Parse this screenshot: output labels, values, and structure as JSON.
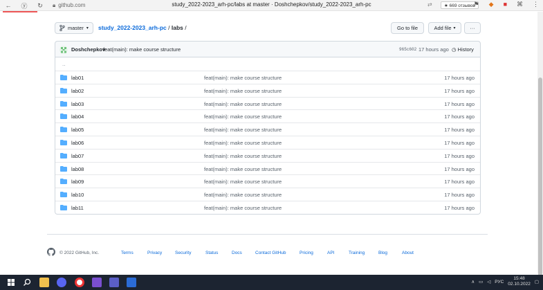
{
  "browser": {
    "url": "github.com",
    "title": "study_2022-2023_arh-pc/labs at master · Doshchepkov/study_2022-2023_arh-pc",
    "reviews_badge": "★ 669 отзывов"
  },
  "toolbar": {
    "branch": "master",
    "repo_name": "study_2022-2023_arh-pc",
    "path_separator": "/",
    "folder": "labs",
    "trailing": "/",
    "go_to_file": "Go to file",
    "add_file": "Add file",
    "more": "···"
  },
  "commit": {
    "author": "Doshchepkov",
    "message": "feat(main): make course structure",
    "sha": "965c602",
    "time": "17 hours ago",
    "history": "History"
  },
  "files": {
    "parent": "..",
    "items": [
      {
        "name": "lab01",
        "message": "feat(main): make course structure",
        "time": "17 hours ago"
      },
      {
        "name": "lab02",
        "message": "feat(main): make course structure",
        "time": "17 hours ago"
      },
      {
        "name": "lab03",
        "message": "feat(main): make course structure",
        "time": "17 hours ago"
      },
      {
        "name": "lab04",
        "message": "feat(main): make course structure",
        "time": "17 hours ago"
      },
      {
        "name": "lab05",
        "message": "feat(main): make course structure",
        "time": "17 hours ago"
      },
      {
        "name": "lab06",
        "message": "feat(main): make course structure",
        "time": "17 hours ago"
      },
      {
        "name": "lab07",
        "message": "feat(main): make course structure",
        "time": "17 hours ago"
      },
      {
        "name": "lab08",
        "message": "feat(main): make course structure",
        "time": "17 hours ago"
      },
      {
        "name": "lab09",
        "message": "feat(main): make course structure",
        "time": "17 hours ago"
      },
      {
        "name": "lab10",
        "message": "feat(main): make course structure",
        "time": "17 hours ago"
      },
      {
        "name": "lab11",
        "message": "feat(main): make course structure",
        "time": "17 hours ago"
      }
    ]
  },
  "footer": {
    "copyright": "© 2022 GitHub, Inc.",
    "links": [
      "Terms",
      "Privacy",
      "Security",
      "Status",
      "Docs",
      "Contact GitHub",
      "Pricing",
      "API",
      "Training",
      "Blog",
      "About"
    ]
  },
  "taskbar": {
    "lang": "РУС",
    "time": "15:48",
    "date": "02.10.2022"
  },
  "colors": {
    "link": "#0969da",
    "folder": "#54aeff",
    "taskbar": "#1c2431"
  }
}
